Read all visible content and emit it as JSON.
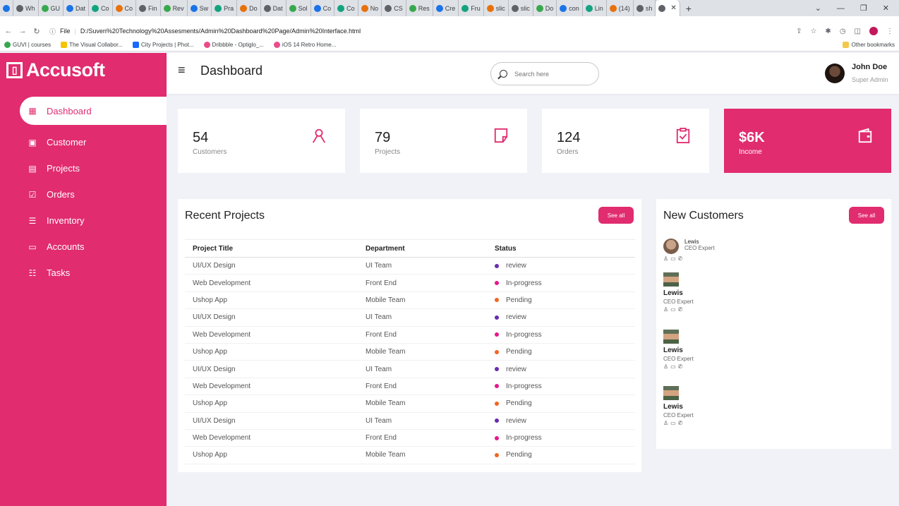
{
  "browser": {
    "tabs": [
      "Wh",
      "GU",
      "Dat",
      "Co",
      "Co",
      "Fin",
      "Rev",
      "Sw",
      "Pra",
      "Do",
      "Dat",
      "Sol",
      "Co",
      "Co",
      "No",
      "CS",
      "Res",
      "Cre",
      "Fru",
      "slic",
      "slic",
      "Do",
      "con",
      "Lin",
      "(14)",
      "sh"
    ],
    "active_tab": "",
    "address": "D:/Suven%20Technology%20Assesments/Admin%20Dashboard%20Page/Admin%20Interface.html",
    "address_prefix": "File",
    "bookmarks": [
      "GUVI | courses",
      "The Visual Collabor...",
      "City Projects | Phot...",
      "Dribbble - Optiglo_...",
      "iOS 14 Retro Home..."
    ],
    "other_bookmarks": "Other bookmarks"
  },
  "sidebar": {
    "brand": "Accusoft",
    "items": [
      {
        "label": "Dashboard",
        "icon": "grid-icon"
      },
      {
        "label": "Customer",
        "icon": "id-card-icon"
      },
      {
        "label": "Projects",
        "icon": "document-icon"
      },
      {
        "label": "Orders",
        "icon": "clipboard-icon"
      },
      {
        "label": "Inventory",
        "icon": "stack-icon"
      },
      {
        "label": "Accounts",
        "icon": "credit-card-icon"
      },
      {
        "label": "Tasks",
        "icon": "task-list-icon"
      }
    ]
  },
  "header": {
    "title": "Dashboard",
    "search_placeholder": "Search here",
    "user_name": "John Doe",
    "user_role": "Super Admin"
  },
  "cards": [
    {
      "value": "54",
      "label": "Customers",
      "icon": "person-icon"
    },
    {
      "value": "79",
      "label": "Projects",
      "icon": "note-icon"
    },
    {
      "value": "124",
      "label": "Orders",
      "icon": "clipboard-check-icon"
    },
    {
      "value": "$6K",
      "label": "Income",
      "icon": "wallet-icon"
    }
  ],
  "recent_projects": {
    "title": "Recent Projects",
    "see_all": "See all",
    "columns": [
      "Project Title",
      "Department",
      "Status"
    ],
    "rows": [
      {
        "title": "UI/UX Design",
        "dept": "UI Team",
        "status": "review",
        "color": "#6a2bb0"
      },
      {
        "title": "Web Development",
        "dept": "Front End",
        "status": "In-progress",
        "color": "#e6178c"
      },
      {
        "title": "Ushop App",
        "dept": "Mobile Team",
        "status": "Pending",
        "color": "#f26522"
      },
      {
        "title": "UI/UX Design",
        "dept": "UI Team",
        "status": "review",
        "color": "#6a2bb0"
      },
      {
        "title": "Web Development",
        "dept": "Front End",
        "status": "In-progress",
        "color": "#e6178c"
      },
      {
        "title": "Ushop App",
        "dept": "Mobile Team",
        "status": "Pending",
        "color": "#f26522"
      },
      {
        "title": "UI/UX Design",
        "dept": "UI Team",
        "status": "review",
        "color": "#6a2bb0"
      },
      {
        "title": "Web Development",
        "dept": "Front End",
        "status": "In-progress",
        "color": "#e6178c"
      },
      {
        "title": "Ushop App",
        "dept": "Mobile Team",
        "status": "Pending",
        "color": "#f26522"
      },
      {
        "title": "UI/UX Design",
        "dept": "UI Team",
        "status": "review",
        "color": "#6a2bb0"
      },
      {
        "title": "Web Development",
        "dept": "Front End",
        "status": "In-progress",
        "color": "#e6178c"
      },
      {
        "title": "Ushop App",
        "dept": "Mobile Team",
        "status": "Pending",
        "color": "#f26522"
      }
    ]
  },
  "new_customers": {
    "title": "New Customers",
    "see_all": "See all",
    "items": [
      {
        "name": "Lewis",
        "role": "CEO Expert"
      },
      {
        "name": "Lewis",
        "role": "CEO Expert"
      },
      {
        "name": "Lewis",
        "role": "CEO Expert"
      },
      {
        "name": "Lewis",
        "role": "CEO Expert"
      }
    ]
  },
  "colors": {
    "accent": "#e12c6f",
    "background": "#f1f2f7"
  }
}
